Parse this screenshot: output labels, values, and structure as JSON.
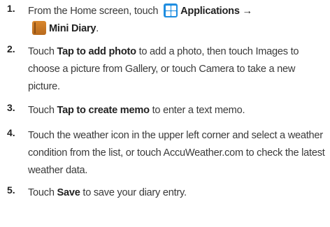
{
  "steps": [
    {
      "number": "1.",
      "prefix": "From the Home screen, touch",
      "app_icon_name": "applications-icon",
      "applications_label": "Applications",
      "arrow": "→",
      "diary_icon_name": "mini-diary-icon",
      "mini_diary_label": "Mini Diary",
      "suffix": "."
    },
    {
      "number": "2.",
      "touch": "Touch ",
      "bold": "Tap to add photo",
      "rest": " to add a photo, then touch Images to choose a picture from Gallery, or touch Camera to take a new picture."
    },
    {
      "number": "3.",
      "touch": "Touch ",
      "bold": "Tap to create memo",
      "rest": " to enter a text memo."
    },
    {
      "number": "4.",
      "text": "Touch the weather icon in the upper left corner and select a weather condition from the list, or touch AccuWeather.com to check the latest weather data."
    },
    {
      "number": "5.",
      "touch": "Touch ",
      "bold": "Save",
      "rest": " to save your diary entry."
    }
  ],
  "colors": {
    "text": "#3a3a3a",
    "app_icon": "#1f8de0",
    "diary_icon": "#c97a25"
  }
}
